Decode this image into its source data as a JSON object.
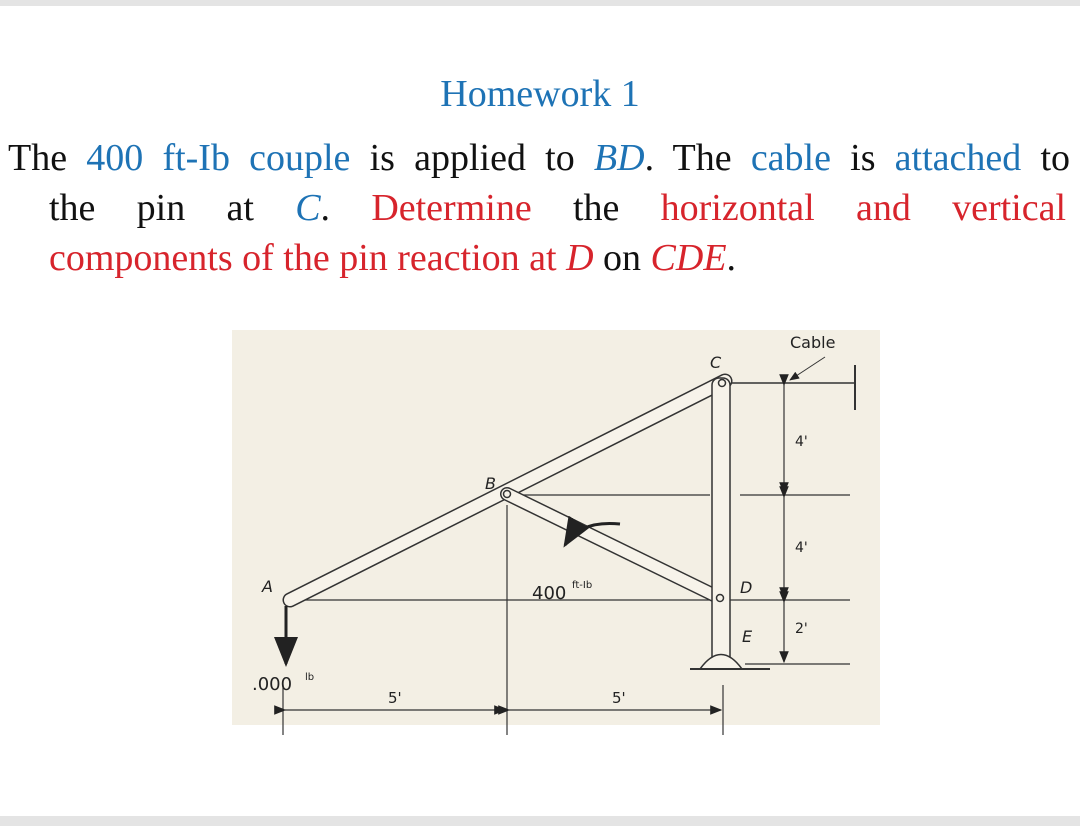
{
  "title": "Homework 1",
  "problem": {
    "line1": [
      {
        "t": "The ",
        "c": ""
      },
      {
        "t": "400 ft-Ib couple",
        "c": "blue"
      },
      {
        "t": " is applied to ",
        "c": ""
      },
      {
        "t": "BD",
        "c": "blue it"
      },
      {
        "t": ". The ",
        "c": ""
      },
      {
        "t": "cable",
        "c": "blue"
      },
      {
        "t": " is ",
        "c": ""
      },
      {
        "t": "attached",
        "c": "blue"
      },
      {
        "t": " to",
        "c": ""
      }
    ],
    "line2": [
      {
        "t": "the pin at ",
        "c": ""
      },
      {
        "t": "C",
        "c": "blue it"
      },
      {
        "t": ". ",
        "c": ""
      },
      {
        "t": "Determine",
        "c": "red"
      },
      {
        "t": " the ",
        "c": ""
      },
      {
        "t": "horizontal and vertical",
        "c": "red"
      }
    ],
    "line3": [
      {
        "t": "components of the pin reaction at ",
        "c": "red"
      },
      {
        "t": "D",
        "c": "red it"
      },
      {
        "t": " on ",
        "c": ""
      },
      {
        "t": "CDE",
        "c": "red it"
      },
      {
        "t": ".",
        "c": ""
      }
    ]
  },
  "diagram": {
    "labels": {
      "A": "A",
      "B": "B",
      "C": "C",
      "D": "D",
      "E": "E",
      "cable": "Cable"
    },
    "couple": "400",
    "couple_unit": "ft-Ib",
    "load": ".000",
    "load_unit": "lb",
    "dims": {
      "v1": "4'",
      "v2": "4'",
      "v3": "2'",
      "h1": "5'",
      "h2": "5'"
    }
  },
  "colors": {
    "blue": "#1e73b5",
    "red": "#d7242c",
    "paper": "#f3efe4"
  }
}
